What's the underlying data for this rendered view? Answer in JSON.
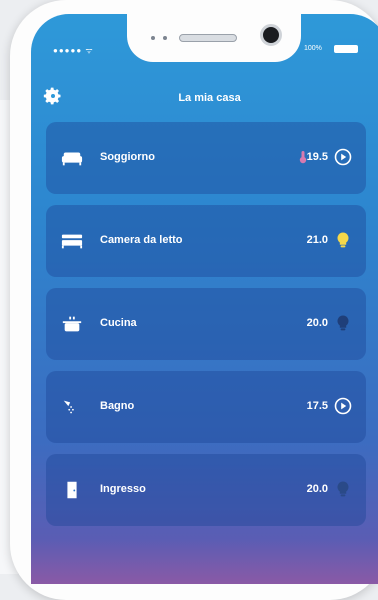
{
  "status_bar": {
    "carrier": "●●●●● ᯤ",
    "battery_text": "100%"
  },
  "header": {
    "title": "La mia casa",
    "settings_icon": "gear-icon"
  },
  "rooms": [
    {
      "name": "Soggiorno",
      "temperature": "19.5",
      "icon": "sofa-icon",
      "status_icon": "play-circle-icon",
      "extra_icon": "thermometer-icon"
    },
    {
      "name": "Camera da letto",
      "temperature": "21.0",
      "icon": "bed-icon",
      "status_icon": "lightbulb-on-icon"
    },
    {
      "name": "Cucina",
      "temperature": "20.0",
      "icon": "cooking-pot-icon",
      "status_icon": "lightbulb-off-icon"
    },
    {
      "name": "Bagno",
      "temperature": "17.5",
      "icon": "shower-icon",
      "status_icon": "play-circle-icon"
    },
    {
      "name": "Ingresso",
      "temperature": "20.0",
      "icon": "door-icon",
      "status_icon": "lightbulb-off-icon"
    }
  ],
  "colors": {
    "bulb_on": "#f5d84a",
    "bulb_off": "#1f3f7a",
    "thermometer": "#d77ab0"
  }
}
